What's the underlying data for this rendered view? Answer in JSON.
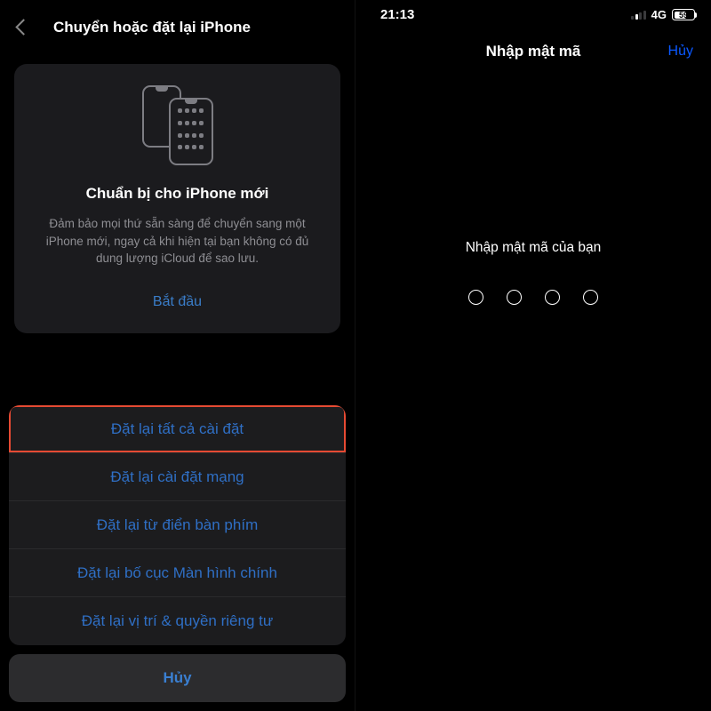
{
  "left": {
    "nav_title": "Chuyển hoặc đặt lại iPhone",
    "card": {
      "title": "Chuẩn bị cho iPhone mới",
      "description": "Đảm bảo mọi thứ sẵn sàng để chuyển sang một iPhone mới, ngay cả khi hiện tại bạn không có đủ dung lượng iCloud để sao lưu.",
      "start_label": "Bắt đầu"
    },
    "sheet": {
      "items": [
        "Đặt lại tất cả cài đặt",
        "Đặt lại cài đặt mạng",
        "Đặt lại từ điển bàn phím",
        "Đặt lại bố cục Màn hình chính",
        "Đặt lại vị trí & quyền riêng tư"
      ],
      "cancel": "Hủy"
    }
  },
  "right": {
    "status": {
      "time": "21:13",
      "network": "4G",
      "battery_pct": "59"
    },
    "nav_title": "Nhập mật mã",
    "cancel": "Hủy",
    "prompt": "Nhập mật mã của bạn",
    "passcode_slots": 4
  }
}
